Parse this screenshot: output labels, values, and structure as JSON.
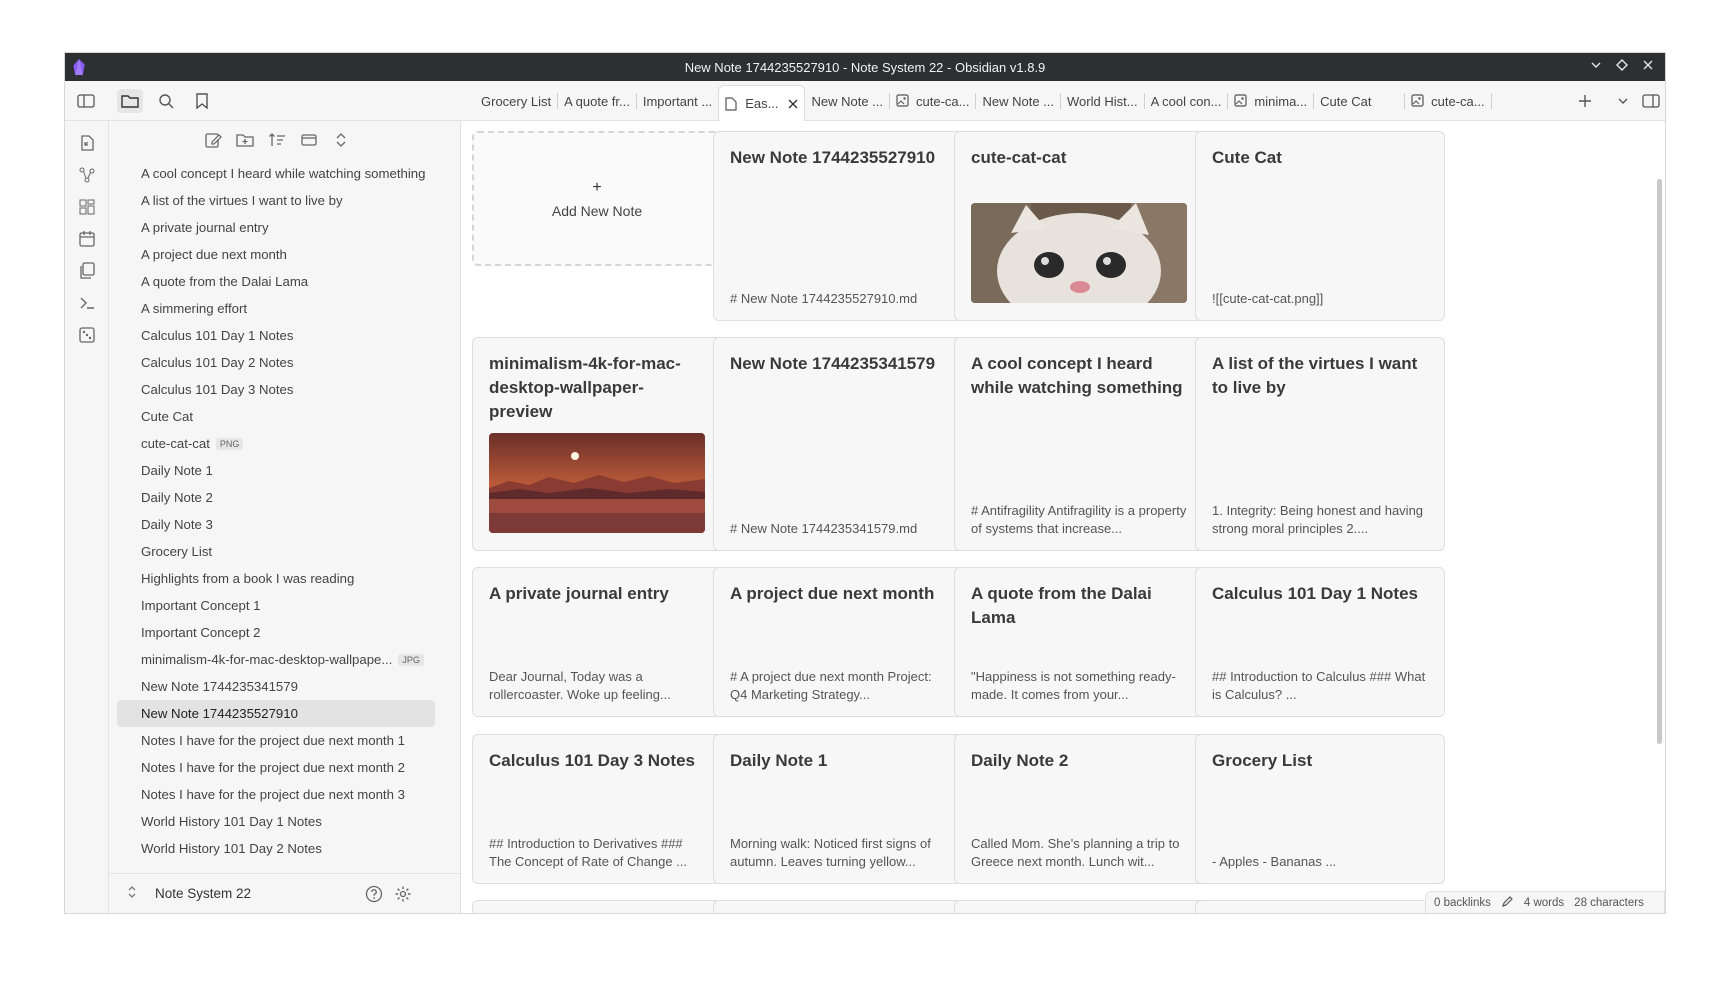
{
  "window": {
    "title": "New Note 1744235527910 - Note System 22 - Obsidian v1.8.9"
  },
  "tabs": [
    {
      "label": "Grocery List",
      "icon": "none"
    },
    {
      "label": "A quote fr...",
      "icon": "none"
    },
    {
      "label": "Important ...",
      "icon": "none"
    },
    {
      "label": "Eas...",
      "icon": "file-icon",
      "active": true
    },
    {
      "label": "New Note ...",
      "icon": "none"
    },
    {
      "label": "cute-ca...",
      "icon": "image-icon"
    },
    {
      "label": "New Note ...",
      "icon": "none"
    },
    {
      "label": "World Hist...",
      "icon": "none"
    },
    {
      "label": "A cool con...",
      "icon": "none"
    },
    {
      "label": "minima...",
      "icon": "image-icon"
    },
    {
      "label": "Cute Cat",
      "icon": "none"
    },
    {
      "label": "cute-ca...",
      "icon": "image-icon"
    }
  ],
  "files": [
    {
      "label": "A cool concept I heard while watching something"
    },
    {
      "label": "A list of the virtues I want to live by"
    },
    {
      "label": "A private journal entry"
    },
    {
      "label": "A project due next month"
    },
    {
      "label": "A quote from the Dalai Lama"
    },
    {
      "label": "A simmering effort"
    },
    {
      "label": "Calculus 101 Day 1 Notes"
    },
    {
      "label": "Calculus 101 Day 2 Notes"
    },
    {
      "label": "Calculus 101 Day 3 Notes"
    },
    {
      "label": "Cute Cat"
    },
    {
      "label": "cute-cat-cat",
      "badge": "PNG"
    },
    {
      "label": "Daily Note 1"
    },
    {
      "label": "Daily Note 2"
    },
    {
      "label": "Daily Note 3"
    },
    {
      "label": "Grocery List"
    },
    {
      "label": "Highlights from a book I was reading"
    },
    {
      "label": "Important Concept 1"
    },
    {
      "label": "Important Concept 2"
    },
    {
      "label": "minimalism-4k-for-mac-desktop-wallpape...",
      "badge": "JPG"
    },
    {
      "label": "New Note 1744235341579"
    },
    {
      "label": "New Note 1744235527910",
      "active": true
    },
    {
      "label": "Notes I have for the project due next month 1"
    },
    {
      "label": "Notes I have for the project due next month 2"
    },
    {
      "label": "Notes I have for the project due next month 3"
    },
    {
      "label": "World History 101 Day 1 Notes"
    },
    {
      "label": "World History 101 Day 2 Notes"
    }
  ],
  "vault": {
    "name": "Note System 22"
  },
  "add_card": {
    "plus": "+",
    "label": "Add New Note"
  },
  "cards": [
    {
      "title": "New Note 1744235527910",
      "preview": "# New Note 1744235527910.md"
    },
    {
      "title": "cute-cat-cat",
      "preview": ""
    },
    {
      "title": "Cute Cat",
      "preview": "![[cute-cat-cat.png]]"
    },
    {
      "title": "minimalism-4k-for-mac-desktop-wallpaper-preview",
      "preview": ""
    },
    {
      "title": "New Note 1744235341579",
      "preview": "# New Note 1744235341579.md"
    },
    {
      "title": "A cool concept I heard while watching something",
      "preview": "# Antifragility Antifragility is a property of systems that increase..."
    },
    {
      "title": "A list of the virtues I want to live by",
      "preview": "1. Integrity: Being honest and having strong moral principles 2...."
    },
    {
      "title": "A private journal entry",
      "preview": "Dear Journal, Today was a rollercoaster. Woke up feeling..."
    },
    {
      "title": "A project due next month",
      "preview": "# A project due next month Project: Q4 Marketing Strategy..."
    },
    {
      "title": "A quote from the Dalai Lama",
      "preview": "\"Happiness is not something ready-made. It comes from your..."
    },
    {
      "title": "Calculus 101 Day 1 Notes",
      "preview": "## Introduction to Calculus ### What is Calculus? ..."
    },
    {
      "title": "Calculus 101 Day 3 Notes",
      "preview": "## Introduction to Derivatives ### The Concept of Rate of Change ..."
    },
    {
      "title": "Daily Note 1",
      "preview": "Morning walk: Noticed first signs of autumn. Leaves turning yellow..."
    },
    {
      "title": "Daily Note 2",
      "preview": "Called Mom. She's planning a trip to Greece next month. Lunch wit..."
    },
    {
      "title": "Grocery List",
      "preview": "- Apples - Bananas ..."
    }
  ],
  "status": {
    "backlinks": "0 backlinks",
    "words": "4 words",
    "characters": "28 characters"
  }
}
